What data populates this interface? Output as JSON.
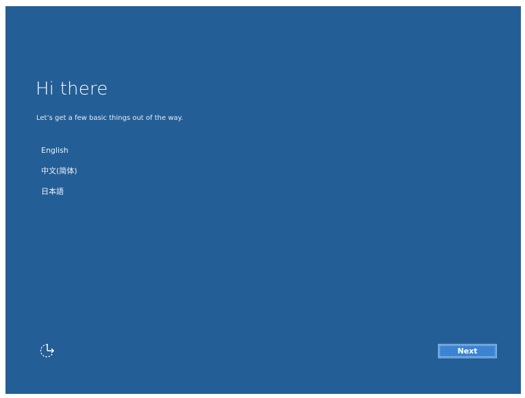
{
  "setup": {
    "title": "Hi there",
    "subtitle": "Let’s get a few basic things out of the way.",
    "languages": [
      {
        "label": "English"
      },
      {
        "label": "中文(简体)"
      },
      {
        "label": "日本語"
      }
    ],
    "next_label": "Next"
  },
  "icons": {
    "ease_of_access": "ease-of-access-icon"
  },
  "colors": {
    "background": "#245e96",
    "button": "#3b84d2",
    "text": "#ffffff"
  }
}
